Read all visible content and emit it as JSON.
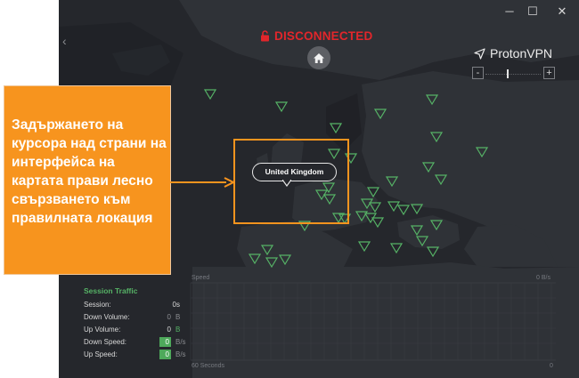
{
  "status": {
    "label": "DISCONNECTED",
    "color": "#e2262b"
  },
  "brand": {
    "name": "ProtonVPN"
  },
  "zoom": {
    "minus": "-",
    "plus": "+",
    "level": 0.4
  },
  "map": {
    "hover_country": "United Kingdom",
    "marker_color": "#56b366"
  },
  "graph": {
    "title": "Speed",
    "top_right": "0 B/s",
    "bottom_left": "60 Seconds",
    "bottom_right": "0"
  },
  "session_traffic": {
    "title": "Session Traffic",
    "rows": [
      {
        "label": "Session:",
        "value": "0s",
        "unit": ""
      },
      {
        "label": "Down Volume:",
        "value": "0",
        "unit": "B"
      },
      {
        "label": "Up Volume:",
        "value": "0",
        "unit": "B"
      },
      {
        "label": "Down Speed:",
        "value": "0",
        "unit": "B/s"
      },
      {
        "label": "Up Speed:",
        "value": "0",
        "unit": "B/s"
      }
    ]
  },
  "callout": {
    "text": "Задържането на курсора над страни на интерфейса на картата прави лесно свързването към правилната локация",
    "color": "#f7941e"
  },
  "window_controls": {
    "minimize": "─",
    "maximize": "☐",
    "close": "✕"
  }
}
